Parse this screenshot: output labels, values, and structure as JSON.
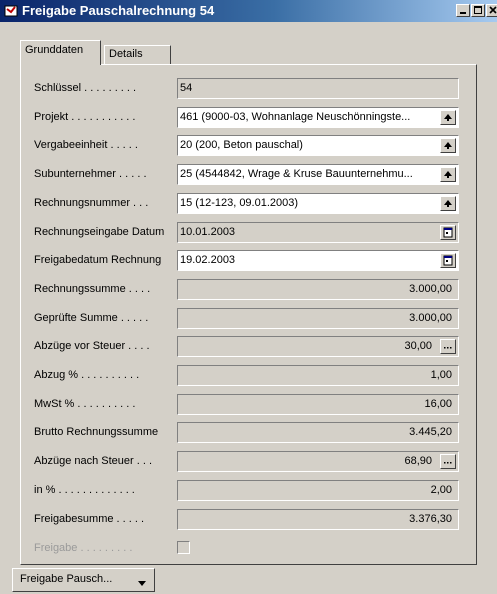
{
  "window": {
    "title": "Freigabe Pauschalrechnung 54"
  },
  "tabs": [
    {
      "label": "Grunddaten"
    },
    {
      "label": "Details"
    }
  ],
  "fields": [
    {
      "label": "Schlüssel . . . . . . . . .",
      "value": "54",
      "style": "grey",
      "button": "none"
    },
    {
      "label": "Projekt . . . . . . . . . . .",
      "value": "461 (9000-03, Wohnanlage Neuschönningste...",
      "style": "white",
      "button": "dropdown"
    },
    {
      "label": "Vergabeeinheit . . . . .",
      "value": "20 (200, Beton pauschal)",
      "style": "white",
      "button": "dropdown"
    },
    {
      "label": "Subunternehmer . . . . .",
      "value": "25 (4544842, Wrage & Kruse Bauunternehmu...",
      "style": "white",
      "button": "dropdown"
    },
    {
      "label": "Rechnungsnummer . . .",
      "value": "15 (12-123, 09.01.2003)",
      "style": "white",
      "button": "dropdown"
    },
    {
      "label": "Rechnungseingabe Datum",
      "value": "10.01.2003",
      "style": "grey",
      "button": "calendar"
    },
    {
      "label": "Freigabedatum Rechnung",
      "value": "19.02.2003",
      "style": "white",
      "button": "calendar"
    },
    {
      "label": "Rechnungssumme . . . .",
      "value": "3.000,00",
      "style": "grey-num",
      "button": "none"
    },
    {
      "label": "Geprüfte Summe . . . . .",
      "value": "3.000,00",
      "style": "grey-num",
      "button": "none"
    },
    {
      "label": "Abzüge vor Steuer . . . .",
      "value": "30,00",
      "style": "grey-num",
      "button": "ellipsis"
    },
    {
      "label": "Abzug % . . . . . . . . . .",
      "value": "1,00",
      "style": "grey-num",
      "button": "none"
    },
    {
      "label": "MwSt % . . . . . . . . . .",
      "value": "16,00",
      "style": "grey-num",
      "button": "none"
    },
    {
      "label": "Brutto Rechnungssumme",
      "value": "3.445,20",
      "style": "grey-num",
      "button": "none"
    },
    {
      "label": "Abzüge nach Steuer . . .",
      "value": "68,90",
      "style": "grey-num",
      "button": "ellipsis"
    },
    {
      "label": "in % . . . . . . . . . . . . .",
      "value": "2,00",
      "style": "grey-num",
      "button": "none"
    },
    {
      "label": "Freigabesumme . . . . .",
      "value": "3.376,30",
      "style": "grey-num",
      "button": "none"
    }
  ],
  "freigabe": {
    "label": "Freigabe . . . . . . . . .",
    "checked": false
  },
  "bottom_button": {
    "label": "Freigabe Pausch..."
  },
  "colors": {
    "titlebar": "#0a246a",
    "face": "#d4d0c8",
    "disabled_text": "#9a9a9a"
  }
}
